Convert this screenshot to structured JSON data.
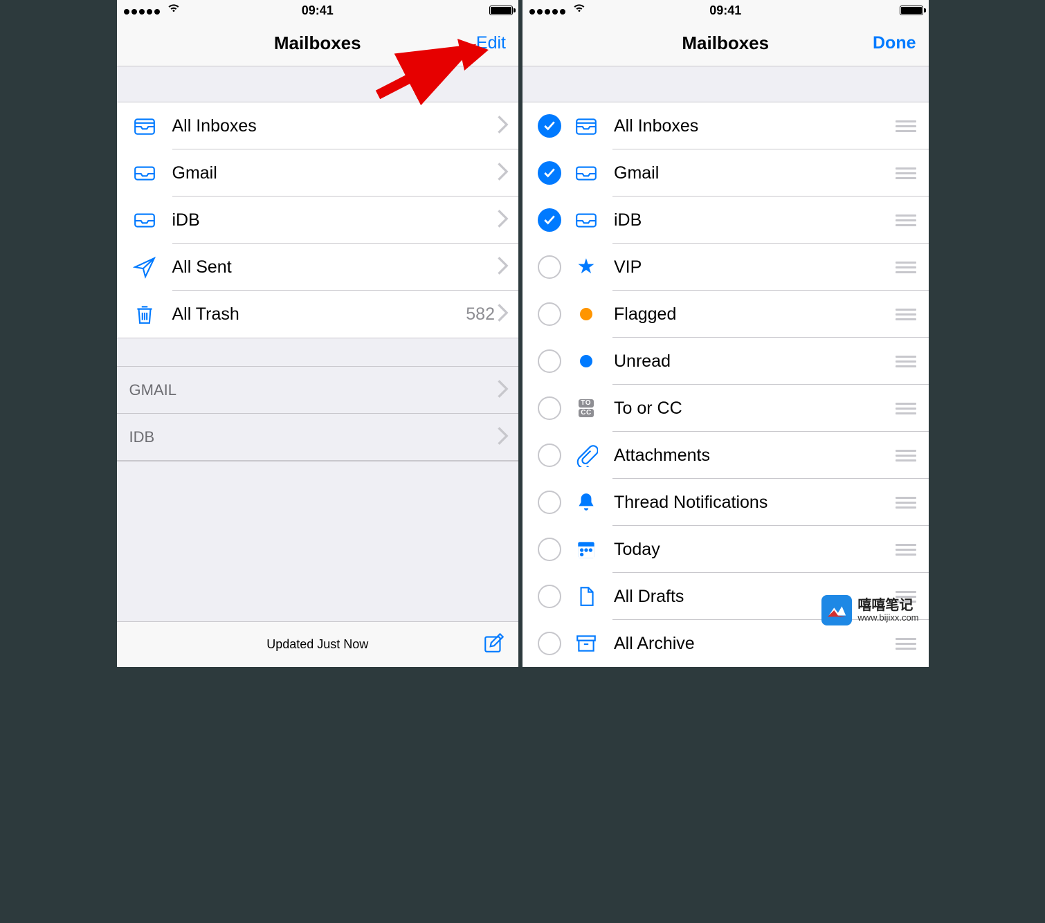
{
  "status": {
    "time": "09:41"
  },
  "left": {
    "title": "Mailboxes",
    "right_button": "Edit",
    "mailboxes": [
      {
        "icon": "all-inboxes",
        "label": "All Inboxes"
      },
      {
        "icon": "inbox",
        "label": "Gmail"
      },
      {
        "icon": "inbox",
        "label": "iDB"
      },
      {
        "icon": "sent",
        "label": "All Sent"
      },
      {
        "icon": "trash",
        "label": "All Trash",
        "count": "582"
      }
    ],
    "accounts": [
      {
        "label": "GMAIL"
      },
      {
        "label": "IDB"
      }
    ],
    "footer_status": "Updated Just Now"
  },
  "right": {
    "title": "Mailboxes",
    "right_button": "Done",
    "items": [
      {
        "checked": true,
        "icon": "all-inboxes",
        "label": "All Inboxes"
      },
      {
        "checked": true,
        "icon": "inbox",
        "label": "Gmail"
      },
      {
        "checked": true,
        "icon": "inbox",
        "label": "iDB"
      },
      {
        "checked": false,
        "icon": "star",
        "label": "VIP"
      },
      {
        "checked": false,
        "icon": "flag-dot",
        "label": "Flagged"
      },
      {
        "checked": false,
        "icon": "unread-dot",
        "label": "Unread"
      },
      {
        "checked": false,
        "icon": "tocc",
        "label": "To or CC"
      },
      {
        "checked": false,
        "icon": "clip",
        "label": "Attachments"
      },
      {
        "checked": false,
        "icon": "bell",
        "label": "Thread Notifications"
      },
      {
        "checked": false,
        "icon": "today",
        "label": "Today"
      },
      {
        "checked": false,
        "icon": "draft",
        "label": "All Drafts"
      },
      {
        "checked": false,
        "icon": "archive",
        "label": "All Archive"
      }
    ]
  },
  "watermark": {
    "brand": "嘻嘻笔记",
    "url": "www.bijixx.com"
  }
}
